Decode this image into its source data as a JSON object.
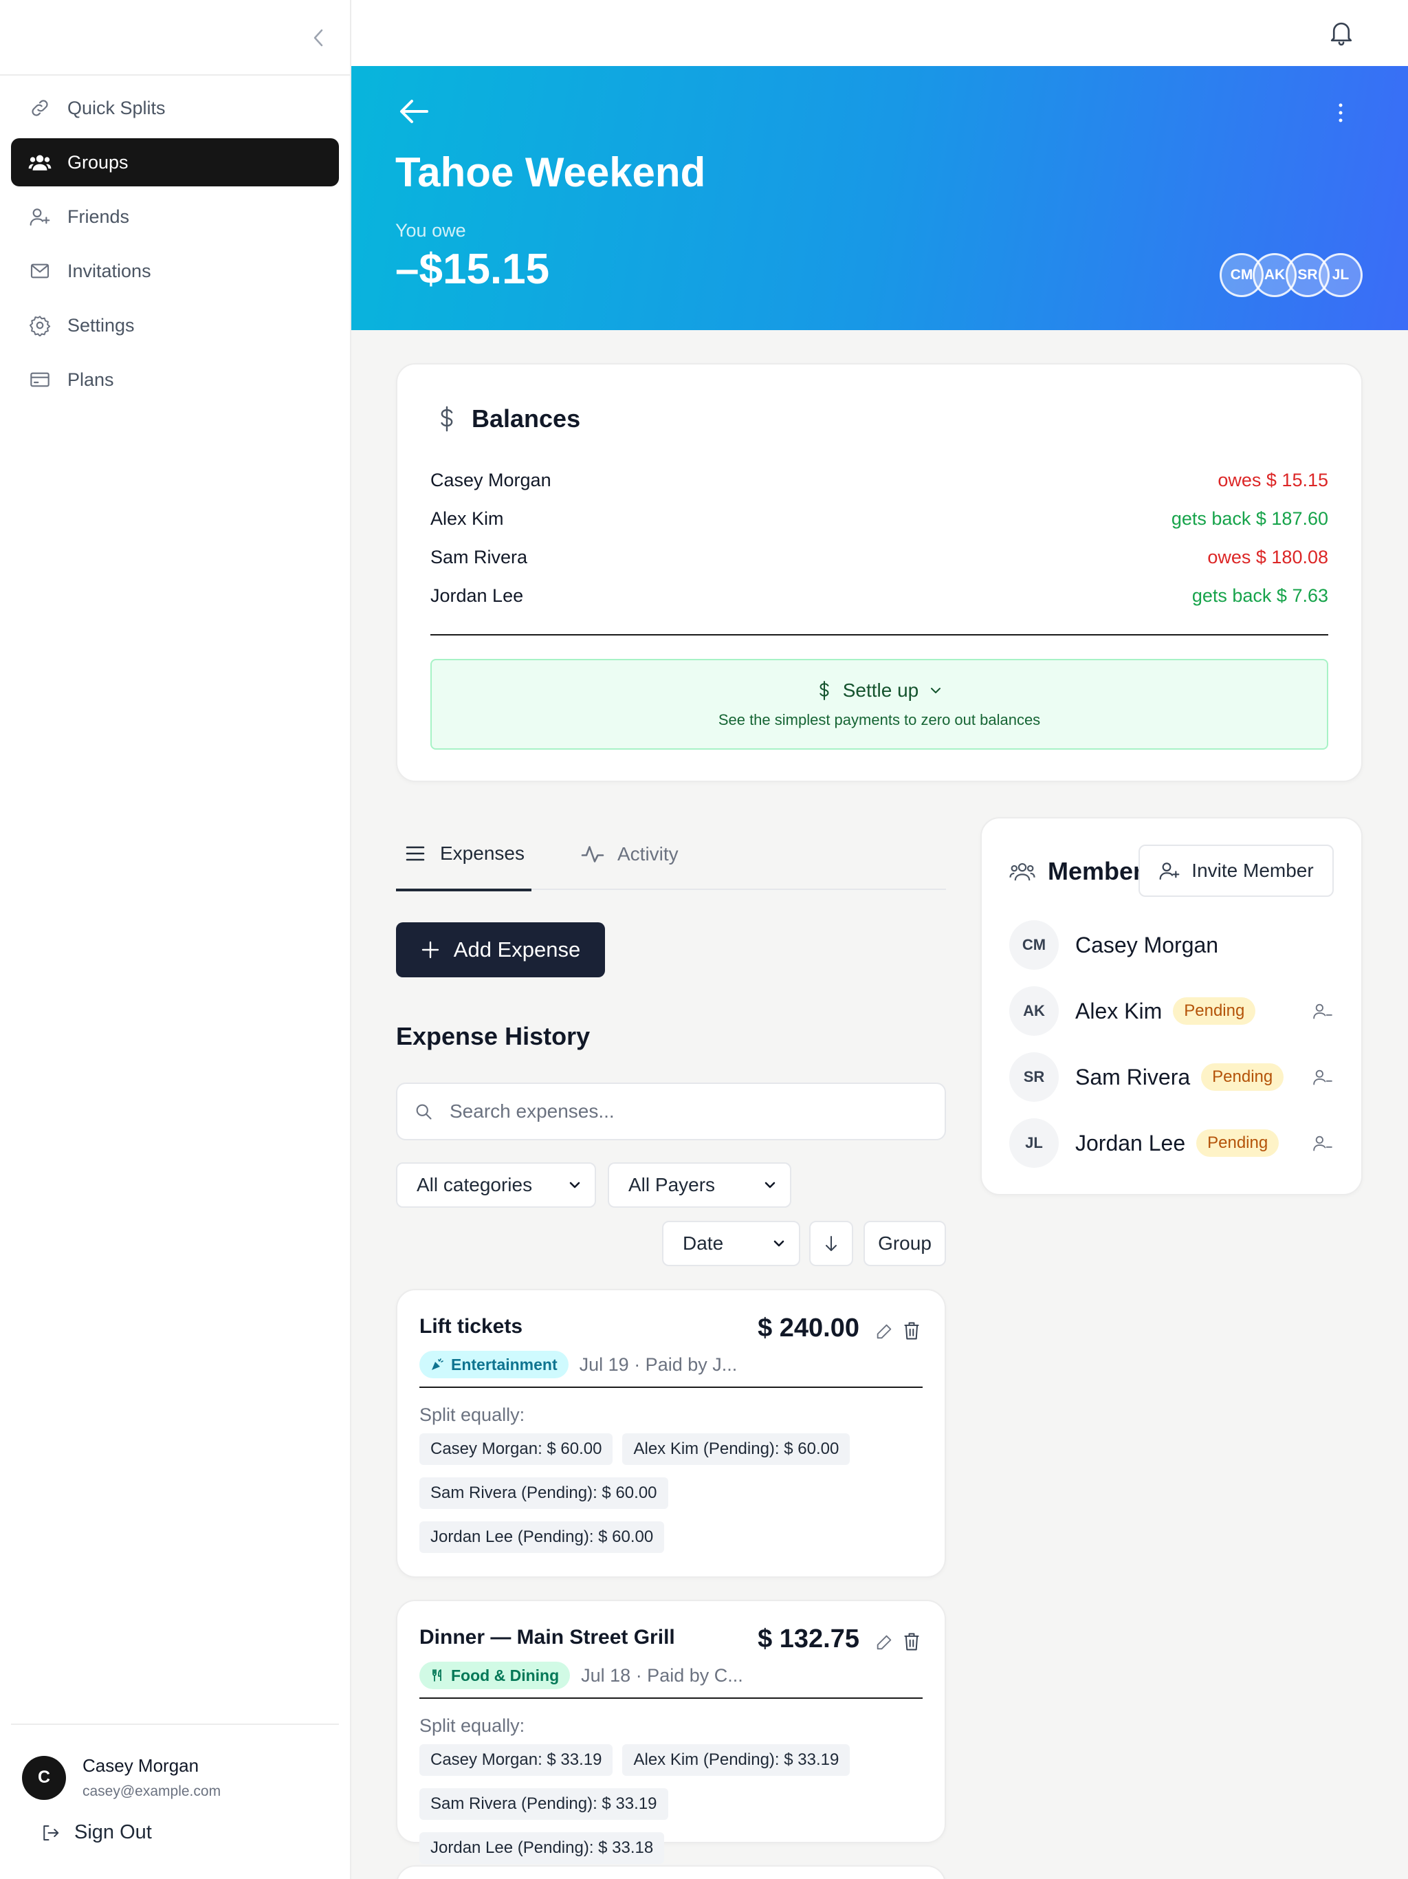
{
  "sidebar": {
    "items": [
      {
        "label": "Quick Splits",
        "icon": "link-icon"
      },
      {
        "label": "Groups",
        "icon": "users-icon"
      },
      {
        "label": "Friends",
        "icon": "user-plus-icon"
      },
      {
        "label": "Invitations",
        "icon": "mail-icon"
      },
      {
        "label": "Settings",
        "icon": "gear-icon"
      },
      {
        "label": "Plans",
        "icon": "card-icon"
      }
    ],
    "user": {
      "initial": "C",
      "name": "Casey Morgan",
      "email": "casey@example.com"
    },
    "signout_label": "Sign Out"
  },
  "group": {
    "title": "Tahoe Weekend",
    "owe_label": "You owe",
    "owe_amount": "–$15.15",
    "member_initials": [
      "CM",
      "AK",
      "SR",
      "JL"
    ]
  },
  "balances": {
    "title": "Balances",
    "rows": [
      {
        "name": "Casey Morgan",
        "text": "owes $ 15.15",
        "status": "owes"
      },
      {
        "name": "Alex Kim",
        "text": "gets back $ 187.60",
        "status": "gets"
      },
      {
        "name": "Sam Rivera",
        "text": "owes $ 180.08",
        "status": "owes"
      },
      {
        "name": "Jordan Lee",
        "text": "gets back $ 7.63",
        "status": "gets"
      }
    ],
    "settle_label": "Settle up",
    "settle_sub": "See the simplest payments to zero out balances"
  },
  "tabs": {
    "expenses": "Expenses",
    "activity": "Activity"
  },
  "add_expense_label": "Add Expense",
  "history": {
    "title": "Expense History",
    "search_placeholder": "Search expenses...",
    "category_filter": "All categories",
    "payer_filter": "All Payers",
    "sort_field": "Date",
    "group_label": "Group"
  },
  "expenses": [
    {
      "title": "Lift tickets",
      "amount": "$ 240.00",
      "category": "Entertainment",
      "meta": "Jul 19 · Paid by J...",
      "split_label": "Split equally:",
      "splits": [
        "Casey Morgan: $ 60.00",
        "Alex Kim (Pending): $ 60.00",
        "Sam Rivera (Pending): $ 60.00",
        "Jordan Lee (Pending): $ 60.00"
      ]
    },
    {
      "title": "Dinner — Main Street Grill",
      "amount": "$ 132.75",
      "category": "Food & Dining",
      "meta": "Jul 18 · Paid by C...",
      "split_label": "Split equally:",
      "splits": [
        "Casey Morgan: $ 33.19",
        "Alex Kim (Pending): $ 33.19",
        "Sam Rivera (Pending): $ 33.19",
        "Jordan Lee (Pending): $ 33.18"
      ]
    }
  ],
  "members": {
    "title": "Members",
    "invite_label": "Invite Member",
    "list": [
      {
        "initials": "CM",
        "name": "Casey Morgan",
        "status": ""
      },
      {
        "initials": "AK",
        "name": "Alex Kim",
        "status": "Pending"
      },
      {
        "initials": "SR",
        "name": "Sam Rivera",
        "status": "Pending"
      },
      {
        "initials": "JL",
        "name": "Jordan Lee",
        "status": "Pending"
      }
    ]
  },
  "colors": {
    "owes": "#dc2626",
    "gets": "#16a34a",
    "accent": "#1a2236"
  }
}
